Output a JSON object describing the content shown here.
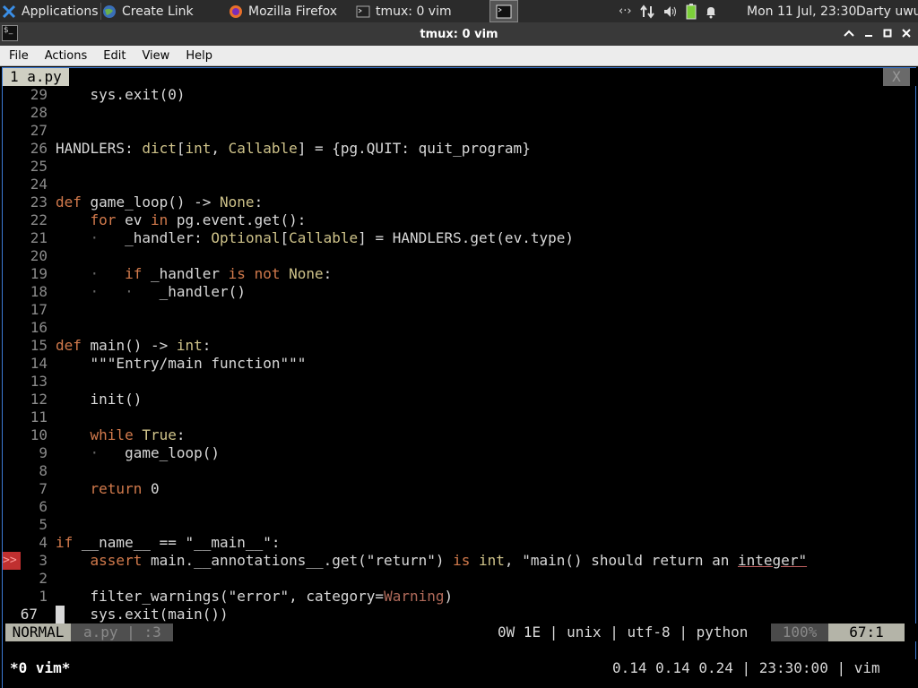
{
  "taskbar": {
    "apps_label": "Applications",
    "tasks": [
      {
        "label": "Create Link",
        "icon": "globe-icon"
      },
      {
        "label": "Mozilla Firefox",
        "icon": "firefox-icon"
      },
      {
        "label": "tmux: 0 vim",
        "icon": "terminal-icon"
      }
    ],
    "clock": "Mon 11 Jul, 23:30",
    "user": "Darty uwu"
  },
  "window": {
    "title": "tmux: 0 vim",
    "menu": [
      "File",
      "Actions",
      "Edit",
      "View",
      "Help"
    ]
  },
  "vim": {
    "tab_label": "1  a.py",
    "tab_close": "X",
    "lines": [
      {
        "num": "29",
        "text": "    sys.exit(0)"
      },
      {
        "num": "28",
        "text": ""
      },
      {
        "num": "27",
        "text": ""
      },
      {
        "num": "26",
        "text": "HANDLERS: dict[int, Callable] = {pg.QUIT: quit_program}"
      },
      {
        "num": "25",
        "text": ""
      },
      {
        "num": "24",
        "text": ""
      },
      {
        "num": "23",
        "text": "def game_loop() -> None:"
      },
      {
        "num": "22",
        "text": "    for ev in pg.event.get():"
      },
      {
        "num": "21",
        "text": "    ·   _handler: Optional[Callable] = HANDLERS.get(ev.type)"
      },
      {
        "num": "20",
        "text": ""
      },
      {
        "num": "19",
        "text": "    ·   if _handler is not None:"
      },
      {
        "num": "18",
        "text": "    ·   ·   _handler()"
      },
      {
        "num": "17",
        "text": ""
      },
      {
        "num": "16",
        "text": ""
      },
      {
        "num": "15",
        "text": "def main() -> int:"
      },
      {
        "num": "14",
        "text": "    \"\"\"Entry/main function\"\"\""
      },
      {
        "num": "13",
        "text": ""
      },
      {
        "num": "12",
        "text": "    init()"
      },
      {
        "num": "11",
        "text": ""
      },
      {
        "num": "10",
        "text": "    while True:"
      },
      {
        "num": "9",
        "text": "    ·   game_loop()"
      },
      {
        "num": "8",
        "text": ""
      },
      {
        "num": "7",
        "text": "    return 0"
      },
      {
        "num": "6",
        "text": ""
      },
      {
        "num": "5",
        "text": ""
      },
      {
        "num": "4",
        "text": "if __name__ == \"__main__\":"
      },
      {
        "num": "3",
        "text": "    assert main.__annotations__.get(\"return\") is int, \"main() should return an integer\"",
        "sign": ">>"
      },
      {
        "num": "2",
        "text": ""
      },
      {
        "num": "1",
        "text": "    filter_warnings(\"error\", category=Warning)"
      },
      {
        "num": "67",
        "text": "    sys.exit(main())",
        "current": true
      }
    ],
    "status": {
      "mode": "NORMAL",
      "file": "a.py",
      "extra": ":3",
      "diagnostics": "0W 1E",
      "format": "unix",
      "encoding": "utf-8",
      "filetype": "python",
      "percent": "100%",
      "position": "67:1"
    }
  },
  "tmux": {
    "window": "*0 vim*",
    "right": "0.14 0.14 0.24 | 23:30:00 | vim"
  }
}
